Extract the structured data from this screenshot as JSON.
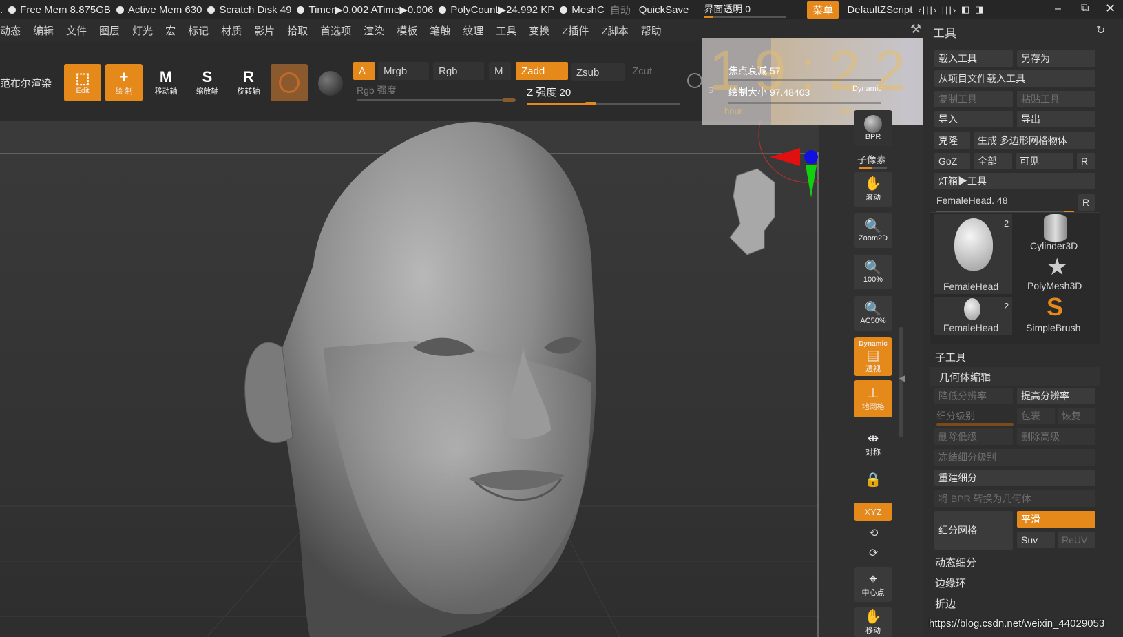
{
  "status": {
    "lead": ".",
    "free_mem": "Free Mem 8.875GB",
    "active_mem": "Active Mem 630",
    "scratch": "Scratch Disk 49",
    "timer": "Timer▶0.002 ATime▶0.006",
    "polycount": "PolyCount▶24.992 KP",
    "meshc": "MeshC",
    "auto": "自动",
    "quicksave": "QuickSave",
    "transparency": "界面透明 0",
    "menu_btn": "菜单",
    "script": "DefaultZScript"
  },
  "menu": [
    "动态",
    "编辑",
    "文件",
    "图层",
    "灯光",
    "宏",
    "标记",
    "材质",
    "影片",
    "拾取",
    "首选项",
    "渲染",
    "模板",
    "笔触",
    "纹理",
    "工具",
    "变换",
    "Z插件",
    "Z脚本",
    "帮助"
  ],
  "toolbar": {
    "render": "范布尔渲染",
    "edit": "Edit",
    "draw": "绘 制",
    "move": "移动轴",
    "scale": "缩放轴",
    "rotate": "旋转轴",
    "a": "A",
    "mrgb": "Mrgb",
    "rgb": "Rgb",
    "m": "M",
    "zadd": "Zadd",
    "zsub": "Zsub",
    "zcut": "Zcut",
    "rgb_intensity": "Rgb 强度",
    "z_intensity": "Z 强度 20",
    "s": "S"
  },
  "overlay": {
    "time": "19:22:45",
    "hour": "hour",
    "min": "min",
    "sec": "sec",
    "focal": "焦点衰减 57",
    "draw_size": "绘制大小 97.48403",
    "dynamic": "Dynamic"
  },
  "vstrip": {
    "bpr": "BPR",
    "subpixel": "子像素",
    "scroll": "滚动",
    "zoom2d": "Zoom2D",
    "p100": "100%",
    "ac50": "AC50%",
    "dynamic": "Dynamic",
    "persp": "透视",
    "floor": "地网格",
    "sym": "对称",
    "xyz": "XYZ",
    "center": "中心点",
    "move": "移动"
  },
  "panel": {
    "title": "工具",
    "load_tool": "载入工具",
    "save_as": "另存为",
    "load_from_project": "从项目文件载入工具",
    "copy_tool": "复制工具",
    "paste_tool": "粘贴工具",
    "import": "导入",
    "export": "导出",
    "clone": "克隆",
    "make_polymesh": "生成 多边形网格物体",
    "goz": "GoZ",
    "all": "全部",
    "visible": "可见",
    "r": "R",
    "lightbox": "灯箱▶工具",
    "current_tool": "FemaleHead. 48",
    "tools": [
      {
        "name": "FemaleHead",
        "count": "2"
      },
      {
        "name": "Cylinder3D",
        "count": ""
      },
      {
        "name": "PolyMesh3D",
        "count": ""
      },
      {
        "name": "FemaleHead",
        "count": "2"
      },
      {
        "name": "SimpleBrush",
        "count": ""
      }
    ],
    "subtool": "子工具",
    "geometry": "几何体编辑",
    "lower_res": "降低分辨率",
    "higher_res": "提高分辨率",
    "sdiv": "细分级别",
    "cage": "包裹",
    "restore": "恢复",
    "del_lower": "删除低级",
    "del_higher": "删除高级",
    "freeze": "冻结细分级别",
    "reconstruct": "重建细分",
    "bpr_to_geo": "将 BPR 转换为几何体",
    "divide": "细分网格",
    "smooth": "平滑",
    "suv": "Suv",
    "reuv": "ReUV",
    "dynamic_sub": "动态细分",
    "edge_loop": "边缘环",
    "crease": "折边"
  },
  "watermark": "https://blog.csdn.net/weixin_44029053",
  "colors": {
    "accent": "#e5891a",
    "bg": "#303030"
  }
}
